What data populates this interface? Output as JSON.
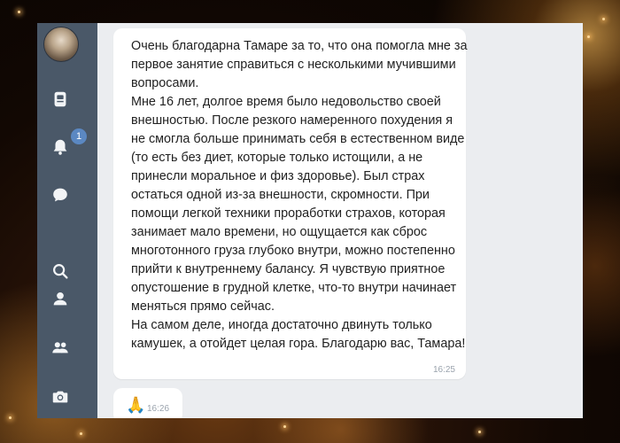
{
  "sidebar": {
    "items": [
      {
        "icon": "document-icon"
      },
      {
        "icon": "bell-icon",
        "badge": "1"
      },
      {
        "icon": "chat-bubble-icon"
      },
      {
        "icon": "search-icon"
      },
      {
        "icon": "person-icon"
      },
      {
        "icon": "group-icon"
      },
      {
        "icon": "camera-icon"
      }
    ],
    "color": "#4a5868"
  },
  "messages": [
    {
      "text": "Очень благодарна Тамаре за то, что она помогла мне за первое занятие справиться с несколькими мучившими вопросами.\nМне 16 лет, долгое время было недовольство своей внешностью. После резкого намеренного похудения я не смогла больше принимать себя в естественном виде (то есть без диет, которые только истощили, а не принесли моральное и физ здоровье). Был страх остаться одной из-за внешности, скромности. При помощи легкой техники проработки страхов, которая занимает мало времени, но ощущается как сброс многотонного груза глубоко внутри, можно постепенно прийти к внутреннему балансу. Я чувствую приятное опустошение в грудной клетке, что-то внутри начинает меняться прямо сейчас.\nНа самом деле, иногда достаточно двинуть только камушек, а отойдет целая гора. Благодарю вас, Тамара!",
      "time": "16:25"
    },
    {
      "emoji": "🙏",
      "time": "16:26"
    }
  ]
}
